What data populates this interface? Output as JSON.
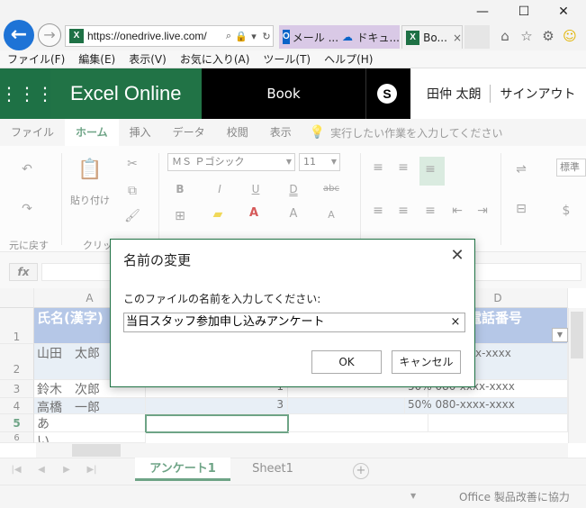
{
  "browser": {
    "url": "https://onedrive.live.com/",
    "tabs": [
      {
        "label": "メール ..."
      },
      {
        "label": "ドキュ..."
      },
      {
        "label": "Bo..."
      }
    ],
    "tab_close": "×",
    "menu": [
      "ファイル(F)",
      "編集(E)",
      "表示(V)",
      "お気に入り(A)",
      "ツール(T)",
      "ヘルプ(H)"
    ],
    "window": {
      "minimize": "—",
      "maximize": "☐",
      "close": "✕"
    }
  },
  "app": {
    "name": "Excel Online",
    "doc_title": "Book",
    "user_name": "田仲 太朗",
    "sign_out": "サインアウト",
    "skype_letter": "S"
  },
  "ribbon": {
    "tabs": [
      "ファイル",
      "ホーム",
      "挿入",
      "データ",
      "校閲",
      "表示"
    ],
    "tell_me": "実行したい作業を入力してください",
    "undo_label": "元に戻す",
    "paste_label": "貼り付け",
    "clipboard_label": "クリップ",
    "font_name": "ＭＳ Ｐゴシック",
    "font_size": "11",
    "number_format": "標準",
    "bold": "B",
    "italic": "I",
    "underline": "U",
    "double_underline": "D",
    "strike": "abc",
    "grow": "A",
    "shrink": "A",
    "currency": "$"
  },
  "formula": {
    "fx": "fx"
  },
  "grid": {
    "columns": [
      "A",
      "D"
    ],
    "rows": [
      "1",
      "2",
      "3",
      "4",
      "5",
      "6"
    ],
    "header_row": {
      "a": "氏名(漢字)",
      "d": "電話番号"
    },
    "r2": {
      "a": "山田　太郎"
    },
    "r3": {
      "a": "鈴木　次郎",
      "b": "1",
      "d": "50% 080-xxxx-xxxx"
    },
    "r4": {
      "a": "高橋　一郎",
      "b": "3",
      "d": "50% 080-xxxx-xxxx"
    },
    "r5": {
      "a": "あ"
    },
    "r6": {
      "a": "い"
    },
    "r2_phone_fragment": "x-xxxx"
  },
  "sheets": [
    "アンケート1",
    "Sheet1"
  ],
  "status": {
    "text": "Office 製品改善に協力"
  },
  "dialog": {
    "title": "名前の変更",
    "prompt": "このファイルの名前を入力してください:",
    "value": "当日スタッフ参加申し込みアンケート",
    "clear": "×",
    "ok": "OK",
    "cancel": "キャンセル",
    "close": "✕"
  },
  "colors": {
    "excel_green": "#217346",
    "header_blue": "#8eaadb",
    "band_blue": "#dce6f2",
    "browser_blue": "#1e73d6"
  }
}
